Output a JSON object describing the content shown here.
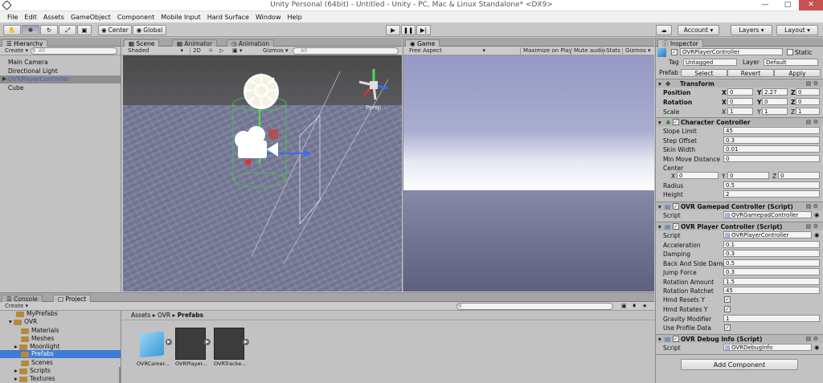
{
  "window": {
    "title": "Unity Personal (64bit) - Untitled - Unity - PC, Mac & Linux Standalone* <DX9>"
  },
  "menu": [
    "File",
    "Edit",
    "Assets",
    "GameObject",
    "Component",
    "Mobile Input",
    "Hard Surface",
    "Window",
    "Help"
  ],
  "toolbar": {
    "pivot": "Center",
    "space": "Global",
    "account": "Account",
    "layers": "Layers",
    "layout": "Layout"
  },
  "hierarchy": {
    "tab": "Hierarchy",
    "create": "Create",
    "search_placeholder": "All",
    "items": [
      "Main Camera",
      "Directional Light",
      "OVRPlayerController",
      "Cube"
    ]
  },
  "scene": {
    "tabs": [
      "Scene",
      "Animator",
      "Animation"
    ],
    "shading": "Shaded",
    "mode2d": "2D",
    "gizmos": "Gizmos",
    "search_placeholder": "All",
    "persp": "Persp"
  },
  "game": {
    "tab": "Game",
    "aspect": "Free Aspect",
    "opts": [
      "Maximize on Play",
      "Mute audio",
      "Stats",
      "Gizmos"
    ]
  },
  "bottom": {
    "tabs": [
      "Console",
      "Project"
    ],
    "create": "Create",
    "tree": [
      "MyPrefabs",
      "OVR",
      "Materials",
      "Meshes",
      "Moonlight",
      "Prefabs",
      "Scenes",
      "Scripts",
      "Textures"
    ],
    "breadcrumb": [
      "Assets",
      "OVR",
      "Prefabs"
    ],
    "assets": [
      "OVRCamer...",
      "OVRPlayer...",
      "OVRTracke..."
    ]
  },
  "inspector": {
    "tab": "Inspector",
    "name": "OVRPlayerController",
    "static": "Static",
    "tag_label": "Tag",
    "tag": "Untagged",
    "layer_label": "Layer",
    "layer": "Default",
    "prefab_label": "Prefab",
    "prefab_btns": [
      "Select",
      "Revert",
      "Apply"
    ],
    "transform": {
      "title": "Transform",
      "rows": [
        {
          "label": "Position",
          "x": "0",
          "y": "2.27",
          "z": "0"
        },
        {
          "label": "Rotation",
          "x": "0",
          "y": "0",
          "z": "0"
        },
        {
          "label": "Scale",
          "x": "1",
          "y": "1",
          "z": "1"
        }
      ]
    },
    "cc": {
      "title": "Character Controller",
      "rows": [
        {
          "label": "Slope Limit",
          "value": "45"
        },
        {
          "label": "Step Offset",
          "value": "0.3"
        },
        {
          "label": "Skin Width",
          "value": "0.01"
        },
        {
          "label": "Min Move Distance",
          "value": "0"
        }
      ],
      "center_label": "Center",
      "center": {
        "x": "0",
        "y": "0",
        "z": "0"
      },
      "radius_label": "Radius",
      "radius": "0.5",
      "height_label": "Height",
      "height": "2"
    },
    "gamepad": {
      "title": "OVR Gamepad Controller (Script)",
      "script_label": "Script",
      "script": "OVRGamepadController"
    },
    "player": {
      "title": "OVR Player Controller (Script)",
      "script_label": "Script",
      "script": "OVRPlayerController",
      "rows": [
        {
          "label": "Acceleration",
          "value": "0.1"
        },
        {
          "label": "Damping",
          "value": "0.3"
        },
        {
          "label": "Back And Side Damp",
          "value": "0.5"
        },
        {
          "label": "Jump Force",
          "value": "0.3"
        },
        {
          "label": "Rotation Amount",
          "value": "1.5"
        },
        {
          "label": "Rotation Ratchet",
          "value": "45"
        }
      ],
      "checks": [
        {
          "label": "Hmd Resets Y"
        },
        {
          "label": "Hmd Rotates Y"
        }
      ],
      "gravity_label": "Gravity Modifier",
      "gravity": "1",
      "profile_label": "Use Profile Data"
    },
    "debug": {
      "title": "OVR Debug Info (Script)",
      "script_label": "Script",
      "script": "OVRDebugInfo"
    },
    "add_component": "Add Component"
  }
}
